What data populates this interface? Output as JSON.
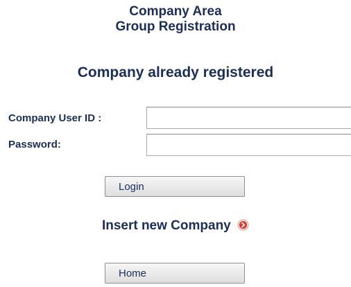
{
  "header": {
    "line1": "Company Area",
    "line2": "Group Registration"
  },
  "login_section": {
    "heading": "Company already registered",
    "user_id_label": "Company User ID :",
    "user_id_value": "",
    "password_label": "Password:",
    "password_value": "",
    "login_button": "Login"
  },
  "insert_link": {
    "label": "Insert new Company",
    "icon": "arrow-right-circle-icon",
    "icon_color": "#e23b2b"
  },
  "home_button": "Home",
  "colors": {
    "text": "#1a2e58"
  }
}
